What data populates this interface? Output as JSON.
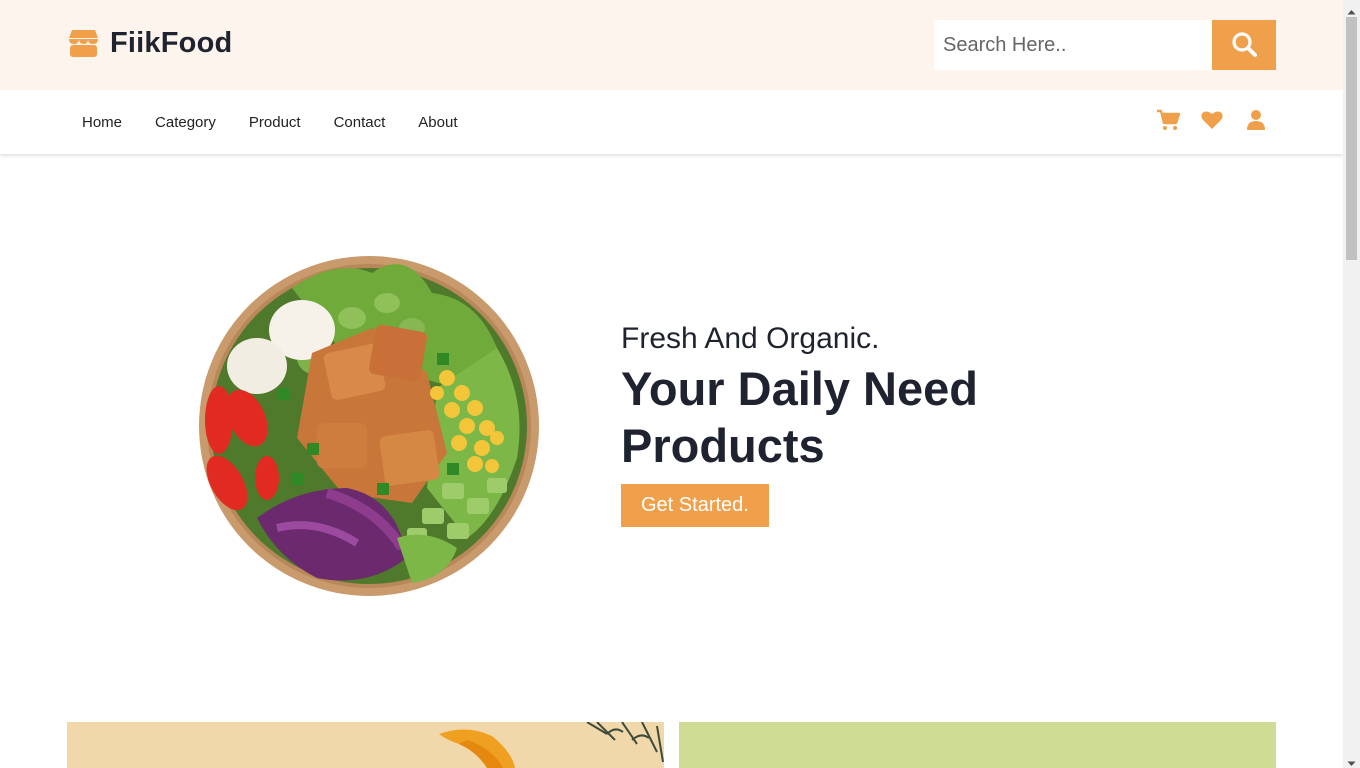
{
  "header": {
    "brand": "FiikFood",
    "logo_icon": "store-icon",
    "search_placeholder": "Search Here..",
    "search_icon": "search-icon"
  },
  "nav": {
    "links": [
      "Home",
      "Category",
      "Product",
      "Contact",
      "About"
    ],
    "icons": [
      "cart-icon",
      "heart-icon",
      "user-icon"
    ]
  },
  "hero": {
    "subtitle": "Fresh And Organic.",
    "title": "Your Daily Need Products",
    "button_label": "Get Started."
  },
  "colors": {
    "accent": "#f0a04b",
    "header_bg": "#fdf4ed",
    "text": "#1f2330",
    "banner_left": "#f0d8ab",
    "banner_right": "#cfdc93"
  }
}
